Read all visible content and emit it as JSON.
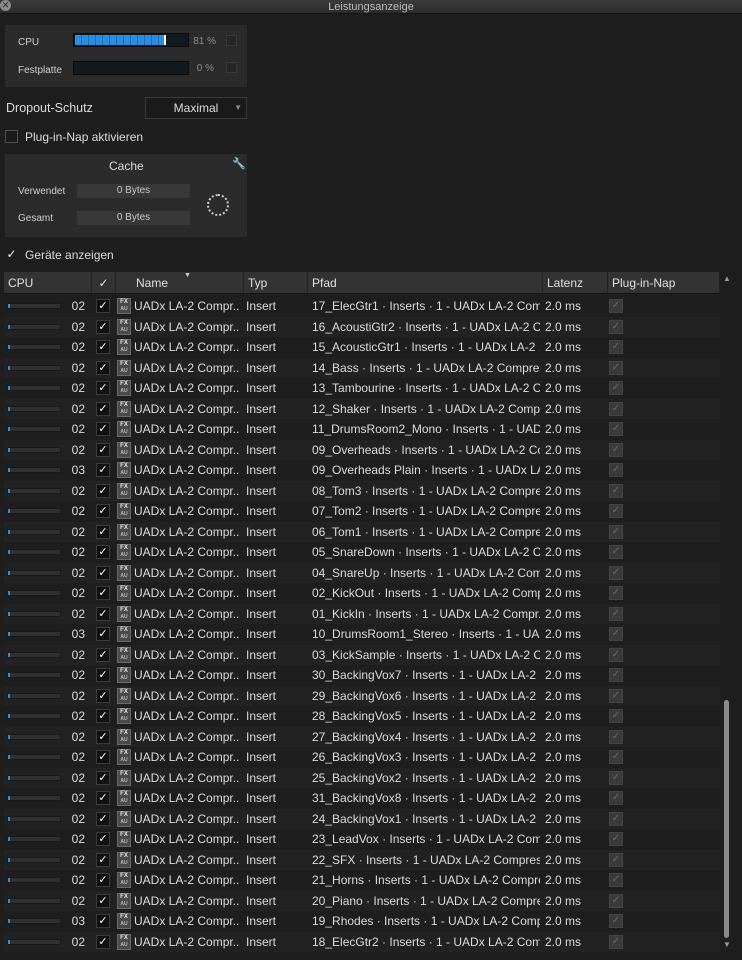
{
  "window": {
    "title": "Leistungsanzeige"
  },
  "meters": {
    "cpu": {
      "label": "CPU",
      "value_text": "81 %",
      "fraction": 0.81
    },
    "disk": {
      "label": "Festplatte",
      "value_text": "0 %",
      "fraction": 0.0
    }
  },
  "dropout": {
    "label": "Dropout-Schutz",
    "value": "Maximal"
  },
  "plugin_nap": {
    "label": "Plug-in-Nap aktivieren",
    "checked": false
  },
  "cache": {
    "title": "Cache",
    "used_label": "Verwendet",
    "used_value": "0 Bytes",
    "total_label": "Gesamt",
    "total_value": "0 Bytes"
  },
  "show_devices": {
    "label": "Geräte anzeigen",
    "checked": true
  },
  "table": {
    "columns": {
      "cpu": "CPU",
      "check": "✓",
      "name": "Name",
      "type": "Typ",
      "path": "Pfad",
      "latency": "Latenz",
      "nap": "Plug-in-Nap"
    },
    "icons": {
      "fx_top": "FX",
      "fx_bottom": "AU"
    },
    "rows": [
      {
        "num": "02",
        "name": "UADx LA-2 Compr..",
        "type": "Insert",
        "path": "17_ElecGtr1 · Inserts · 1 - UADx LA-2 Com..",
        "latency": "2.0 ms"
      },
      {
        "num": "02",
        "name": "UADx LA-2 Compr..",
        "type": "Insert",
        "path": "16_AcoustiGtr2 · Inserts · 1 - UADx LA-2 C..",
        "latency": "2.0 ms"
      },
      {
        "num": "02",
        "name": "UADx LA-2 Compr..",
        "type": "Insert",
        "path": "15_AcousticGtr1 · Inserts · 1 - UADx LA-2 ..",
        "latency": "2.0 ms"
      },
      {
        "num": "02",
        "name": "UADx LA-2 Compr..",
        "type": "Insert",
        "path": "14_Bass · Inserts · 1 - UADx LA-2 Compres..",
        "latency": "2.0 ms"
      },
      {
        "num": "02",
        "name": "UADx LA-2 Compr..",
        "type": "Insert",
        "path": "13_Tambourine · Inserts · 1 - UADx LA-2 C..",
        "latency": "2.0 ms"
      },
      {
        "num": "02",
        "name": "UADx LA-2 Compr..",
        "type": "Insert",
        "path": "12_Shaker · Inserts · 1 - UADx LA-2 Compr..",
        "latency": "2.0 ms"
      },
      {
        "num": "02",
        "name": "UADx LA-2 Compr..",
        "type": "Insert",
        "path": "11_DrumsRoom2_Mono · Inserts · 1 - UAD..",
        "latency": "2.0 ms"
      },
      {
        "num": "02",
        "name": "UADx LA-2 Compr..",
        "type": "Insert",
        "path": "09_Overheads · Inserts · 1 - UADx LA-2 Co..",
        "latency": "2.0 ms"
      },
      {
        "num": "03",
        "name": "UADx LA-2 Compr..",
        "type": "Insert",
        "path": "09_Overheads Plain · Inserts · 1 - UADx LA..",
        "latency": "2.0 ms"
      },
      {
        "num": "02",
        "name": "UADx LA-2 Compr..",
        "type": "Insert",
        "path": "08_Tom3 · Inserts · 1 - UADx LA-2 Compre..",
        "latency": "2.0 ms"
      },
      {
        "num": "02",
        "name": "UADx LA-2 Compr..",
        "type": "Insert",
        "path": "07_Tom2 · Inserts · 1 - UADx LA-2 Compre..",
        "latency": "2.0 ms"
      },
      {
        "num": "02",
        "name": "UADx LA-2 Compr..",
        "type": "Insert",
        "path": "06_Tom1 · Inserts · 1 - UADx LA-2 Compre..",
        "latency": "2.0 ms"
      },
      {
        "num": "02",
        "name": "UADx LA-2 Compr..",
        "type": "Insert",
        "path": "05_SnareDown · Inserts · 1 - UADx LA-2 C..",
        "latency": "2.0 ms"
      },
      {
        "num": "02",
        "name": "UADx LA-2 Compr..",
        "type": "Insert",
        "path": "04_SnareUp · Inserts · 1 - UADx LA-2 Com..",
        "latency": "2.0 ms"
      },
      {
        "num": "02",
        "name": "UADx LA-2 Compr..",
        "type": "Insert",
        "path": "02_KickOut · Inserts · 1 - UADx LA-2 Comp..",
        "latency": "2.0 ms"
      },
      {
        "num": "02",
        "name": "UADx LA-2 Compr..",
        "type": "Insert",
        "path": "01_KickIn · Inserts · 1 - UADx LA-2 Compr..",
        "latency": "2.0 ms"
      },
      {
        "num": "03",
        "name": "UADx LA-2 Compr..",
        "type": "Insert",
        "path": "10_DrumsRoom1_Stereo · Inserts · 1 - UA..",
        "latency": "2.0 ms"
      },
      {
        "num": "02",
        "name": "UADx LA-2 Compr..",
        "type": "Insert",
        "path": "03_KickSample · Inserts · 1 - UADx LA-2 C..",
        "latency": "2.0 ms"
      },
      {
        "num": "02",
        "name": "UADx LA-2 Compr..",
        "type": "Insert",
        "path": "30_BackingVox7 · Inserts · 1 - UADx LA-2 ..",
        "latency": "2.0 ms"
      },
      {
        "num": "02",
        "name": "UADx LA-2 Compr..",
        "type": "Insert",
        "path": "29_BackingVox6 · Inserts · 1 - UADx LA-2 ..",
        "latency": "2.0 ms"
      },
      {
        "num": "02",
        "name": "UADx LA-2 Compr..",
        "type": "Insert",
        "path": "28_BackingVox5 · Inserts · 1 - UADx LA-2 ..",
        "latency": "2.0 ms"
      },
      {
        "num": "02",
        "name": "UADx LA-2 Compr..",
        "type": "Insert",
        "path": "27_BackingVox4 · Inserts · 1 - UADx LA-2 ..",
        "latency": "2.0 ms"
      },
      {
        "num": "02",
        "name": "UADx LA-2 Compr..",
        "type": "Insert",
        "path": "26_BackingVox3 · Inserts · 1 - UADx LA-2 ..",
        "latency": "2.0 ms"
      },
      {
        "num": "02",
        "name": "UADx LA-2 Compr..",
        "type": "Insert",
        "path": "25_BackingVox2 · Inserts · 1 - UADx LA-2 ..",
        "latency": "2.0 ms"
      },
      {
        "num": "02",
        "name": "UADx LA-2 Compr..",
        "type": "Insert",
        "path": "31_BackingVox8 · Inserts · 1 - UADx LA-2 ..",
        "latency": "2.0 ms"
      },
      {
        "num": "02",
        "name": "UADx LA-2 Compr..",
        "type": "Insert",
        "path": "24_BackingVox1 · Inserts · 1 - UADx LA-2 ..",
        "latency": "2.0 ms"
      },
      {
        "num": "02",
        "name": "UADx LA-2 Compr..",
        "type": "Insert",
        "path": "23_LeadVox · Inserts · 1 - UADx LA-2 Com..",
        "latency": "2.0 ms"
      },
      {
        "num": "02",
        "name": "UADx LA-2 Compr..",
        "type": "Insert",
        "path": "22_SFX · Inserts · 1 - UADx LA-2 Compres..",
        "latency": "2.0 ms"
      },
      {
        "num": "02",
        "name": "UADx LA-2 Compr..",
        "type": "Insert",
        "path": "21_Horns · Inserts · 1 - UADx LA-2 Compre..",
        "latency": "2.0 ms"
      },
      {
        "num": "02",
        "name": "UADx LA-2 Compr..",
        "type": "Insert",
        "path": "20_Piano · Inserts · 1 - UADx LA-2 Compre..",
        "latency": "2.0 ms"
      },
      {
        "num": "03",
        "name": "UADx LA-2 Compr..",
        "type": "Insert",
        "path": "19_Rhodes · Inserts · 1 - UADx LA-2 Comp..",
        "latency": "2.0 ms"
      },
      {
        "num": "02",
        "name": "UADx LA-2 Compr..",
        "type": "Insert",
        "path": "18_ElecGtr2 · Inserts · 1 - UADx LA-2 Com..",
        "latency": "2.0 ms"
      }
    ]
  }
}
